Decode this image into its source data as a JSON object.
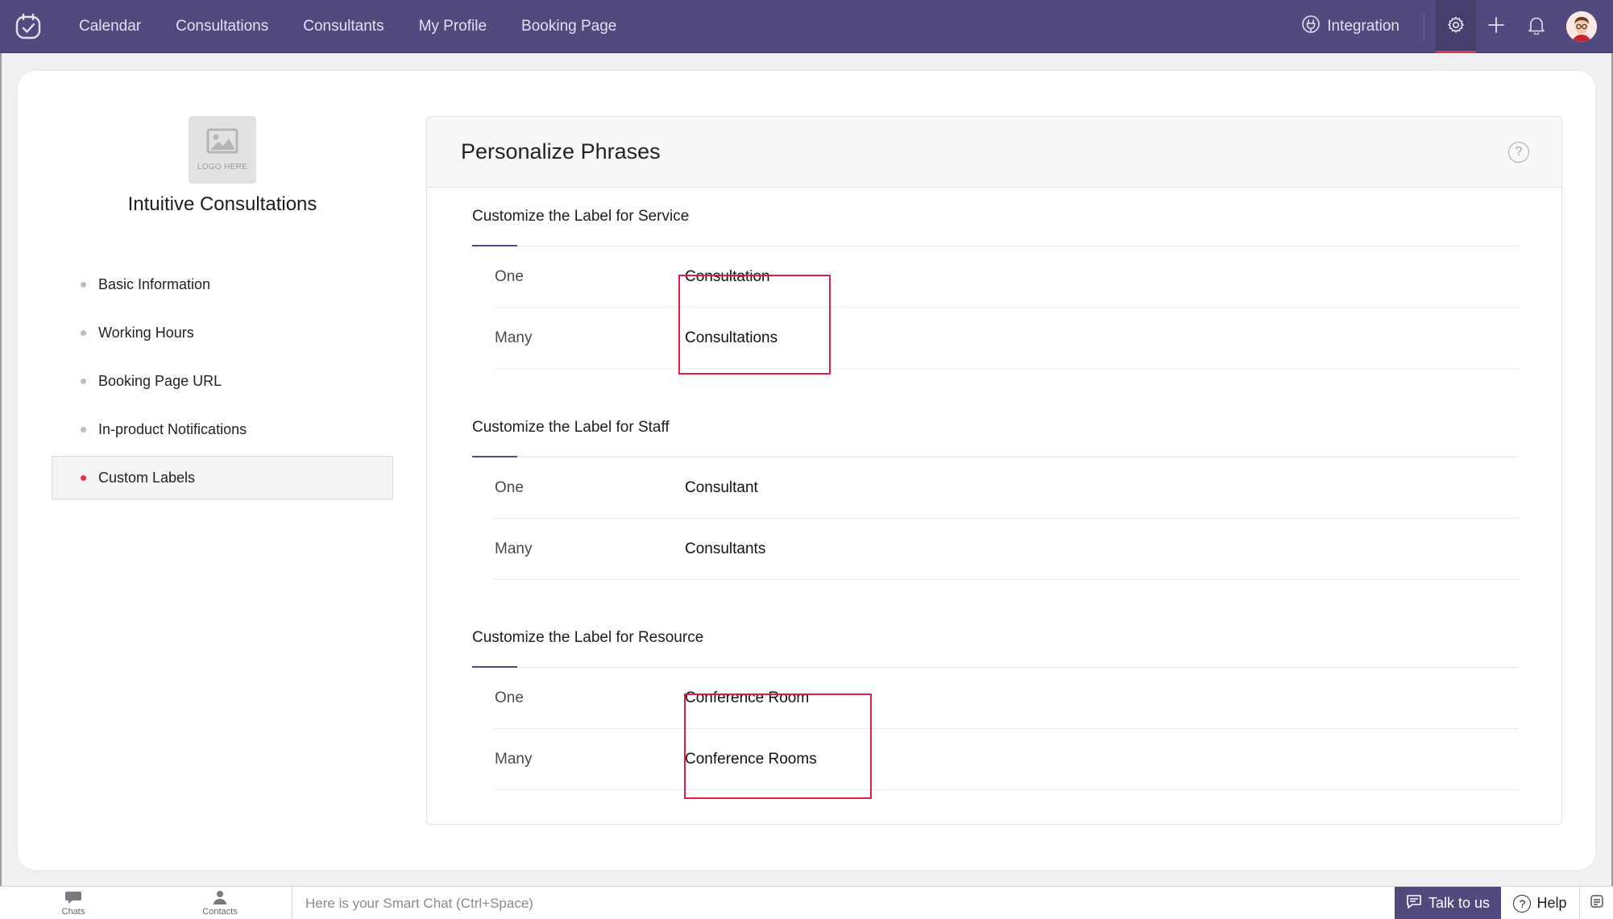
{
  "colors": {
    "brand": "#524a7e",
    "accent_red": "#e8324a",
    "highlight_box": "#e5194a"
  },
  "topnav": {
    "links": [
      {
        "label": "Calendar"
      },
      {
        "label": "Consultations"
      },
      {
        "label": "Consultants"
      },
      {
        "label": "My Profile"
      },
      {
        "label": "Booking Page"
      }
    ],
    "integration_label": "Integration",
    "icons": [
      "app-logo-icon",
      "integration-icon",
      "settings-icon",
      "plus-icon",
      "bell-icon",
      "avatar"
    ]
  },
  "sidebar": {
    "logo_placeholder": "LOGO HERE",
    "business_name": "Intuitive Consultations",
    "items": [
      {
        "label": "Basic Information",
        "active": false
      },
      {
        "label": "Working Hours",
        "active": false
      },
      {
        "label": "Booking Page URL",
        "active": false
      },
      {
        "label": "In-product Notifications",
        "active": false
      },
      {
        "label": "Custom Labels",
        "active": true
      }
    ]
  },
  "panel": {
    "title": "Personalize Phrases",
    "help_symbol": "?",
    "sections": [
      {
        "title": "Customize the Label for Service",
        "rows": [
          {
            "label": "One",
            "value": "Consultation"
          },
          {
            "label": "Many",
            "value": "Consultations"
          }
        ]
      },
      {
        "title": "Customize the Label for Staff",
        "rows": [
          {
            "label": "One",
            "value": "Consultant"
          },
          {
            "label": "Many",
            "value": "Consultants"
          }
        ]
      },
      {
        "title": "Customize the Label for Resource",
        "rows": [
          {
            "label": "One",
            "value": "Conference Room"
          },
          {
            "label": "Many",
            "value": "Conference Rooms"
          }
        ]
      }
    ]
  },
  "bottombar": {
    "chats_label": "Chats",
    "contacts_label": "Contacts",
    "smart_chat_placeholder": "Here is your Smart Chat (Ctrl+Space)",
    "talk_label": "Talk to us",
    "help_label": "Help",
    "help_symbol": "?"
  }
}
